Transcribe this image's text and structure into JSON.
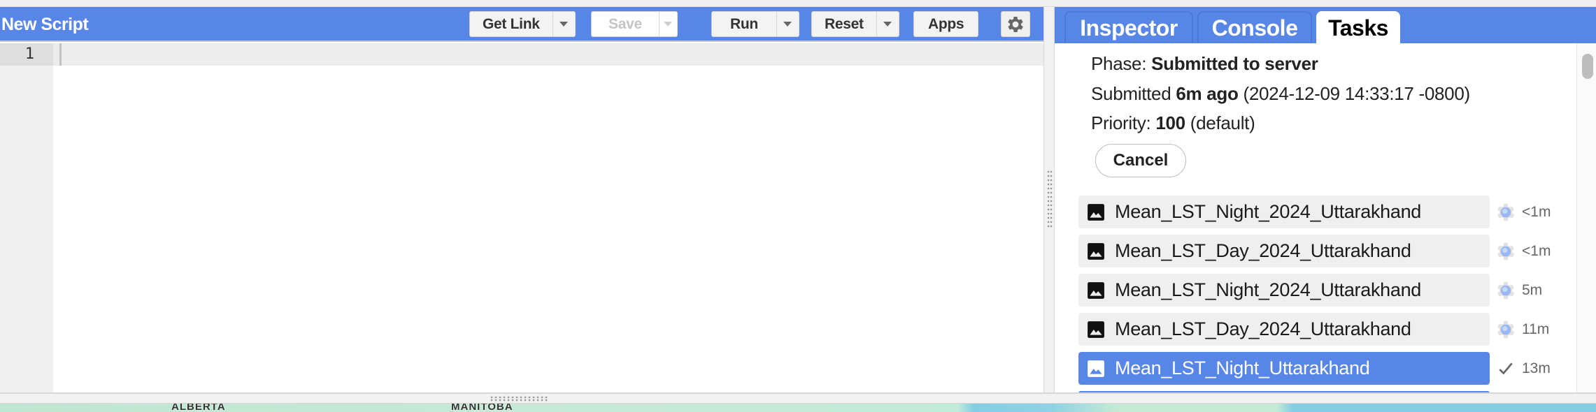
{
  "editor": {
    "title": "New Script",
    "toolbar": {
      "get_link": "Get Link",
      "save": "Save",
      "run": "Run",
      "reset": "Reset",
      "apps": "Apps"
    },
    "line_numbers": [
      "1"
    ]
  },
  "right_panel": {
    "tabs": [
      {
        "label": "Inspector",
        "active": false
      },
      {
        "label": "Console",
        "active": false
      },
      {
        "label": "Tasks",
        "active": true
      }
    ],
    "task_detail": {
      "phase_label": "Phase:",
      "phase_value": "Submitted to server",
      "submitted_label": "Submitted",
      "submitted_ago": "6m ago",
      "submitted_timestamp": "(2024-12-09 14:33:17 -0800)",
      "priority_label": "Priority:",
      "priority_value": "100",
      "priority_note": "(default)",
      "cancel_label": "Cancel"
    },
    "tasks": [
      {
        "name": "Mean_LST_Night_2024_Uttarakhand",
        "status": "running",
        "status_icon": "gear-spinner-icon",
        "time": "<1m",
        "selected": false
      },
      {
        "name": "Mean_LST_Day_2024_Uttarakhand",
        "status": "running",
        "status_icon": "gear-spinner-icon",
        "time": "<1m",
        "selected": false
      },
      {
        "name": "Mean_LST_Night_2024_Uttarakhand",
        "status": "running",
        "status_icon": "gear-spinner-icon",
        "time": "5m",
        "selected": false
      },
      {
        "name": "Mean_LST_Day_2024_Uttarakhand",
        "status": "running",
        "status_icon": "gear-spinner-icon",
        "time": "11m",
        "selected": false
      },
      {
        "name": "Mean_LST_Night_Uttarakhand",
        "status": "completed",
        "status_icon": "checkmark-icon",
        "time": "13m",
        "selected": true
      }
    ]
  },
  "map": {
    "labels": [
      "ALBERTA",
      "MANITOBA"
    ]
  },
  "colors": {
    "accent": "#5886e7",
    "task_bg": "#efefef"
  }
}
